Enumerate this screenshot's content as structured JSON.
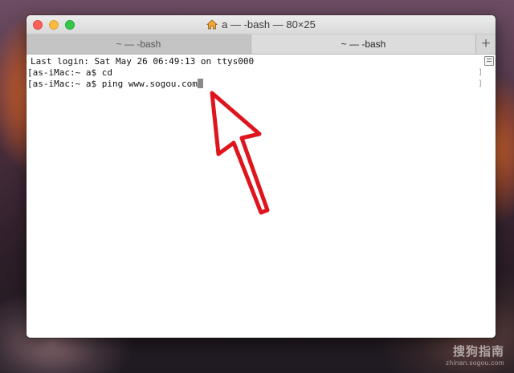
{
  "window": {
    "title": "a — -bash — 80×25",
    "title_icon": "home-icon"
  },
  "tabs": [
    {
      "label": "~ — -bash",
      "active": false
    },
    {
      "label": "~ — -bash",
      "active": true
    }
  ],
  "new_tab_label": "+",
  "terminal": {
    "lines": [
      "Last login: Sat May 26 06:49:13 on ttys000",
      "as-iMac:~ a$ cd",
      "as-iMac:~ a$ ping www.sogou.com"
    ],
    "cursor": "block"
  },
  "annotation": {
    "type": "red-arrow-pointing-up-left",
    "color": "#e0141c"
  },
  "watermark": {
    "title": "搜狗指南",
    "subtitle": "zhinan.sogou.com"
  },
  "colors": {
    "close": "#fc605b",
    "minimize": "#fdbc40",
    "maximize": "#34c84a"
  }
}
